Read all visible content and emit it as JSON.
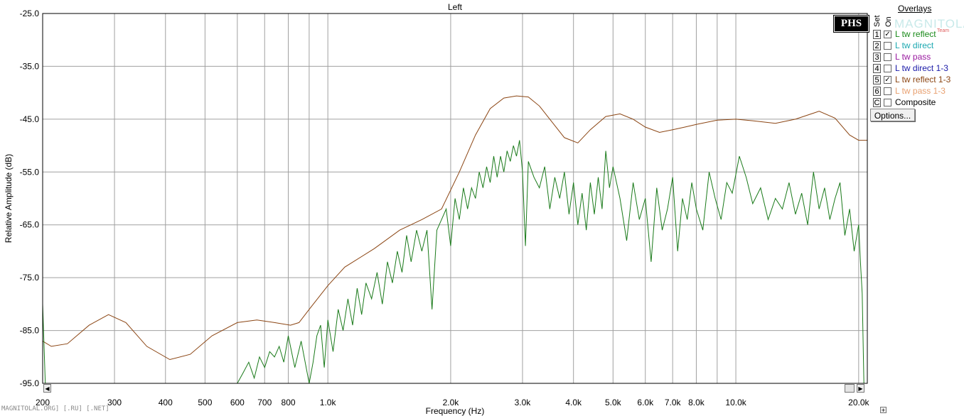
{
  "chart_data": {
    "type": "line",
    "title": "Left",
    "xlabel": "Frequency (Hz)",
    "ylabel": "Relative Amplitude (dB)",
    "x_scale": "log",
    "xlim": [
      200,
      21000
    ],
    "ylim": [
      -95,
      -25
    ],
    "x_ticks": [
      {
        "value": 200,
        "label": "200"
      },
      {
        "value": 300,
        "label": "300"
      },
      {
        "value": 400,
        "label": "400"
      },
      {
        "value": 500,
        "label": "500"
      },
      {
        "value": 600,
        "label": "600"
      },
      {
        "value": 700,
        "label": "700"
      },
      {
        "value": 800,
        "label": "800"
      },
      {
        "value": 1000,
        "label": "1.0k"
      },
      {
        "value": 2000,
        "label": "2.0k"
      },
      {
        "value": 3000,
        "label": "3.0k"
      },
      {
        "value": 4000,
        "label": "4.0k"
      },
      {
        "value": 5000,
        "label": "5.0k"
      },
      {
        "value": 6000,
        "label": "6.0k"
      },
      {
        "value": 7000,
        "label": "7.0k"
      },
      {
        "value": 8000,
        "label": "8.0k"
      },
      {
        "value": 10000,
        "label": "10.0k"
      },
      {
        "value": 20000,
        "label": "20.0k"
      }
    ],
    "minor_x_gridlines": [
      900,
      9000
    ],
    "y_ticks": [
      {
        "value": -25,
        "label": "-25.0"
      },
      {
        "value": -35,
        "label": "-35.0"
      },
      {
        "value": -45,
        "label": "-45.0"
      },
      {
        "value": -55,
        "label": "-55.0"
      },
      {
        "value": -65,
        "label": "-65.0"
      },
      {
        "value": -75,
        "label": "-75.0"
      },
      {
        "value": -85,
        "label": "-85.0"
      },
      {
        "value": -95,
        "label": "-95.0"
      }
    ],
    "grid": true,
    "series": [
      {
        "name": "L tw reflect 1-3",
        "color": "#8b4513",
        "x": [
          200,
          210,
          230,
          260,
          290,
          320,
          360,
          410,
          460,
          520,
          600,
          670,
          740,
          810,
          850,
          900,
          1000,
          1100,
          1300,
          1500,
          1700,
          1900,
          2100,
          2300,
          2500,
          2700,
          2900,
          3100,
          3300,
          3500,
          3800,
          4100,
          4400,
          4800,
          5200,
          5600,
          6000,
          6500,
          7000,
          7500,
          8000,
          9000,
          10000,
          11000,
          12500,
          14000,
          16000,
          17500,
          19000,
          20000,
          21000
        ],
        "y": [
          -87,
          -88,
          -87.5,
          -84,
          -82,
          -83.5,
          -88,
          -90.5,
          -89.5,
          -86,
          -83.5,
          -83,
          -83.5,
          -84,
          -83.5,
          -81,
          -76.5,
          -73,
          -69.5,
          -66,
          -64,
          -62,
          -55,
          -48,
          -43,
          -41,
          -40.6,
          -40.8,
          -42.5,
          -45,
          -48.5,
          -49.5,
          -47,
          -44.5,
          -44,
          -45,
          -46.5,
          -47.5,
          -47,
          -46.5,
          -46,
          -45.2,
          -45,
          -45.3,
          -45.8,
          -45,
          -43.5,
          -44.8,
          -48,
          -49,
          -49
        ]
      },
      {
        "name": "L tw reflect",
        "color": "#1a7a1a",
        "x": [
          200,
          203,
          206,
          300,
          500,
          600,
          620,
          640,
          660,
          680,
          700,
          720,
          740,
          760,
          780,
          800,
          830,
          860,
          900,
          920,
          940,
          960,
          980,
          1000,
          1030,
          1060,
          1090,
          1120,
          1150,
          1180,
          1210,
          1240,
          1280,
          1320,
          1360,
          1400,
          1440,
          1480,
          1520,
          1560,
          1600,
          1650,
          1700,
          1750,
          1800,
          1850,
          1900,
          1950,
          2000,
          2050,
          2100,
          2150,
          2200,
          2250,
          2300,
          2350,
          2400,
          2450,
          2500,
          2550,
          2600,
          2650,
          2700,
          2750,
          2800,
          2850,
          2900,
          2950,
          3000,
          3050,
          3100,
          3200,
          3300,
          3400,
          3500,
          3600,
          3700,
          3800,
          3900,
          4000,
          4100,
          4200,
          4300,
          4400,
          4500,
          4600,
          4700,
          4800,
          4900,
          5000,
          5200,
          5400,
          5600,
          5800,
          6000,
          6200,
          6400,
          6600,
          6800,
          7000,
          7200,
          7400,
          7600,
          7800,
          8000,
          8300,
          8600,
          8900,
          9200,
          9500,
          9800,
          10200,
          10600,
          11000,
          11500,
          12000,
          12500,
          13000,
          13500,
          14000,
          14500,
          15000,
          15500,
          16000,
          16500,
          17000,
          17500,
          18000,
          18500,
          19000,
          19500,
          20000,
          20200,
          20400,
          20600
        ],
        "y": [
          -80,
          -95,
          -95,
          -95,
          -95,
          -95,
          -93,
          -91,
          -94,
          -90,
          -92,
          -89,
          -90,
          -88,
          -91,
          -86,
          -92,
          -87,
          -95,
          -91,
          -86,
          -84,
          -92,
          -83,
          -89,
          -81,
          -85,
          -79,
          -84,
          -77,
          -82,
          -76,
          -79,
          -74,
          -80,
          -72,
          -76,
          -70,
          -74,
          -67,
          -72,
          -66,
          -70,
          -66,
          -81,
          -66,
          -64,
          -62,
          -69,
          -60,
          -64,
          -58,
          -62,
          -58,
          -60,
          -55,
          -58,
          -54,
          -57,
          -52,
          -56,
          -52,
          -55,
          -51,
          -53,
          -50,
          -52,
          -49,
          -55,
          -69,
          -53,
          -56,
          -58,
          -54,
          -62,
          -56,
          -60,
          -55,
          -63,
          -57,
          -65,
          -59,
          -66,
          -57,
          -63,
          -56,
          -62,
          -51,
          -58,
          -54,
          -60,
          -68,
          -57,
          -64,
          -60,
          -72,
          -58,
          -66,
          -62,
          -56,
          -70,
          -60,
          -64,
          -57,
          -62,
          -66,
          -55,
          -60,
          -64,
          -57,
          -59,
          -52,
          -56,
          -61,
          -58,
          -64,
          -60,
          -62,
          -57,
          -63,
          -59,
          -65,
          -55,
          -62,
          -58,
          -64,
          -60,
          -57,
          -67,
          -62,
          -70,
          -65,
          -72,
          -78,
          -95
        ]
      }
    ]
  },
  "overlays": {
    "title": "Overlays",
    "set_header": "Set",
    "on_header": "On",
    "options_label": "Options...",
    "items": [
      {
        "set": "1",
        "checked": true,
        "checkmark": "✓",
        "label": "L tw reflect",
        "color": "#1a8a1a"
      },
      {
        "set": "2",
        "checked": false,
        "checkmark": "",
        "label": "L tw direct",
        "color": "#1aa8b0"
      },
      {
        "set": "3",
        "checked": false,
        "checkmark": "",
        "label": "L tw pass",
        "color": "#9a1aa0"
      },
      {
        "set": "4",
        "checked": false,
        "checkmark": "",
        "label": "L tw direct 1-3",
        "color": "#1a1aa8"
      },
      {
        "set": "5",
        "checked": true,
        "checkmark": "✓",
        "label": "L tw reflect 1-3",
        "color": "#8b4513"
      },
      {
        "set": "6",
        "checked": false,
        "checkmark": "",
        "label": "L tw pass 1-3",
        "color": "#e8a070"
      },
      {
        "set": "C",
        "checked": false,
        "checkmark": "",
        "label": "Composite",
        "color": "#000000"
      }
    ]
  },
  "logo_text": "PHS",
  "watermark": {
    "logo": "MAGNITOLA",
    "team": "Team",
    "text": "MAGNITOLAL.ORG] [.RU] [.NET]"
  },
  "scrollbar": {
    "left_arrow": "◀",
    "right_arrow": "▶",
    "corner": "+"
  },
  "colors": {
    "grid": "#a0a0a0",
    "plot_bg": "#ffffff",
    "axis": "#000000"
  }
}
